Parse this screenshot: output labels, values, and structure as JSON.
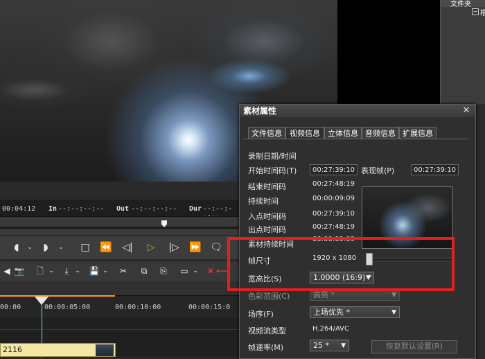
{
  "right_panel": {
    "title": "文件夹",
    "root_label": "根"
  },
  "timecode": {
    "current": "00:04:12",
    "in_label": "In",
    "in_value": "--:--:--:--",
    "out_label": "Out",
    "out_value": "--:--:--:--",
    "dur_label": "Dur",
    "dur_value": "--:--:--:--"
  },
  "ruler": {
    "ticks": [
      "00:00",
      "00:00:05:00",
      "00:00:10:00",
      "00:00:15:0"
    ]
  },
  "clip": {
    "label": "2116"
  },
  "dialog": {
    "title": "素材属性",
    "tabs": [
      "文件信息",
      "视频信息",
      "立体信息",
      "音频信息",
      "扩展信息"
    ],
    "active_tab": "视频信息",
    "section_title": "录制日期/时间",
    "start_tc_label": "开始时间码(T)",
    "start_tc_value": "00:27:39:10",
    "rep_frame_label": "表现帧(P)",
    "rep_frame_value": "00:27:39:10",
    "end_tc_label": "结束时间码",
    "end_tc_value": "00:27:48:19",
    "duration_label": "持续时间",
    "duration_value": "00:00:09:09",
    "in_label": "入点时间码",
    "in_value": "00:27:39:10",
    "out_label": "出点时间码",
    "out_value": "00:27:48:19",
    "clip_duration_label": "素材持续时间",
    "clip_duration_value": "00:00:09:09",
    "frame_size_label": "帧尺寸",
    "frame_size_value": "1920 x 1080",
    "aspect_label": "宽高比(S)",
    "aspect_value": "1.0000 (16:9) *",
    "color_range_label": "色彩范围(C)",
    "color_range_value": "高亮 *",
    "field_order_label": "场序(F)",
    "field_order_value": "上场优先 *",
    "video_type_label": "视频流类型",
    "video_type_value": "H.264/AVC",
    "frame_rate_label": "帧速率(M)",
    "frame_rate_value": "25 *",
    "reset_label": "恢复默认设置(R)",
    "close_glyph": "✕"
  },
  "colors": {
    "highlight": "#e51f1f",
    "clip_fill": "#f3e7a6"
  }
}
